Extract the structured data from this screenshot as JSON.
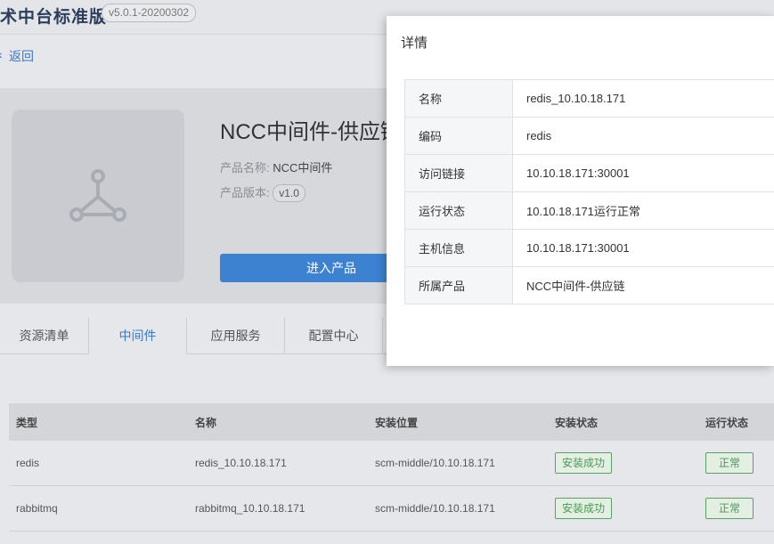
{
  "header": {
    "app_title": "术中台标准版",
    "version": "v5.0.1-20200302"
  },
  "nav": {
    "back_label": "返回"
  },
  "product": {
    "title": "NCC中间件-供应链",
    "name_label": "产品名称:",
    "name_value": "NCC中间件",
    "version_label": "产品版本:",
    "version_value": "v1.0",
    "enter_button": "进入产品"
  },
  "tabs": [
    "资源清单",
    "中间件",
    "应用服务",
    "配置中心"
  ],
  "table": {
    "headers": [
      "类型",
      "名称",
      "安装位置",
      "安装状态",
      "运行状态"
    ],
    "rows": [
      {
        "type": "redis",
        "name": "redis_10.10.18.171",
        "location": "scm-middle/10.10.18.171",
        "install_status": "安装成功",
        "run_status": "正常"
      },
      {
        "type": "rabbitmq",
        "name": "rabbitmq_10.10.18.171",
        "location": "scm-middle/10.10.18.171",
        "install_status": "安装成功",
        "run_status": "正常"
      }
    ]
  },
  "modal": {
    "title": "详情",
    "rows": [
      {
        "key": "名称",
        "value": "redis_10.10.18.171"
      },
      {
        "key": "编码",
        "value": "redis"
      },
      {
        "key": "访问链接",
        "value": "10.10.18.171:30001"
      },
      {
        "key": "运行状态",
        "value": "10.10.18.171运行正常"
      },
      {
        "key": "主机信息",
        "value": "10.10.18.171:30001"
      },
      {
        "key": "所属产品",
        "value": "NCC中间件-供应链"
      }
    ]
  }
}
